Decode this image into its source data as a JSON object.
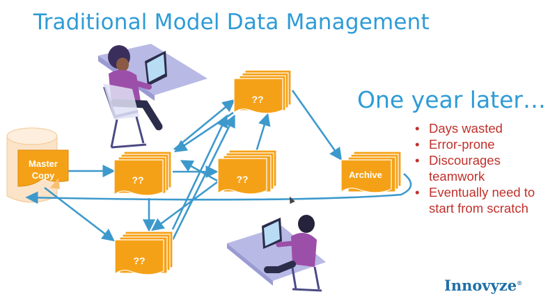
{
  "slide": {
    "title": "Traditional Model Data Management",
    "subtitle": "One year later…",
    "bullets": [
      "Days wasted",
      "Error-prone",
      "Discourages teamwork",
      "Eventually need to start from scratch"
    ],
    "logo": "Innovyze",
    "logo_mark": "®"
  },
  "diagram": {
    "master_copy": [
      "Master",
      "Copy"
    ],
    "unknown_label": "??",
    "archive_label": "Archive"
  },
  "colors": {
    "title": "#2e9bd6",
    "bullet_text": "#c0302b",
    "document_fill": "#f5a117",
    "arrow": "#3d99cc",
    "cylinder": "#fbe3c8"
  }
}
